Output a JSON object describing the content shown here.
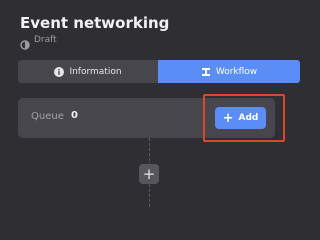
{
  "header": {
    "title": "Event networking",
    "status": "Draft",
    "status_icon": "draft-icon"
  },
  "tabs": [
    {
      "label": "Information",
      "icon": "info-icon",
      "active": false
    },
    {
      "label": "Workflow",
      "icon": "workflow-icon",
      "active": true
    }
  ],
  "queue": {
    "label": "Queue",
    "count": "0",
    "add_label": "Add",
    "add_icon": "plus-icon"
  },
  "add_step": {
    "label": "+",
    "icon": "plus-icon"
  },
  "colors": {
    "background": "#2f2f33",
    "card": "#46464c",
    "accent": "#5a8ef6",
    "highlight": "#d9482a"
  }
}
